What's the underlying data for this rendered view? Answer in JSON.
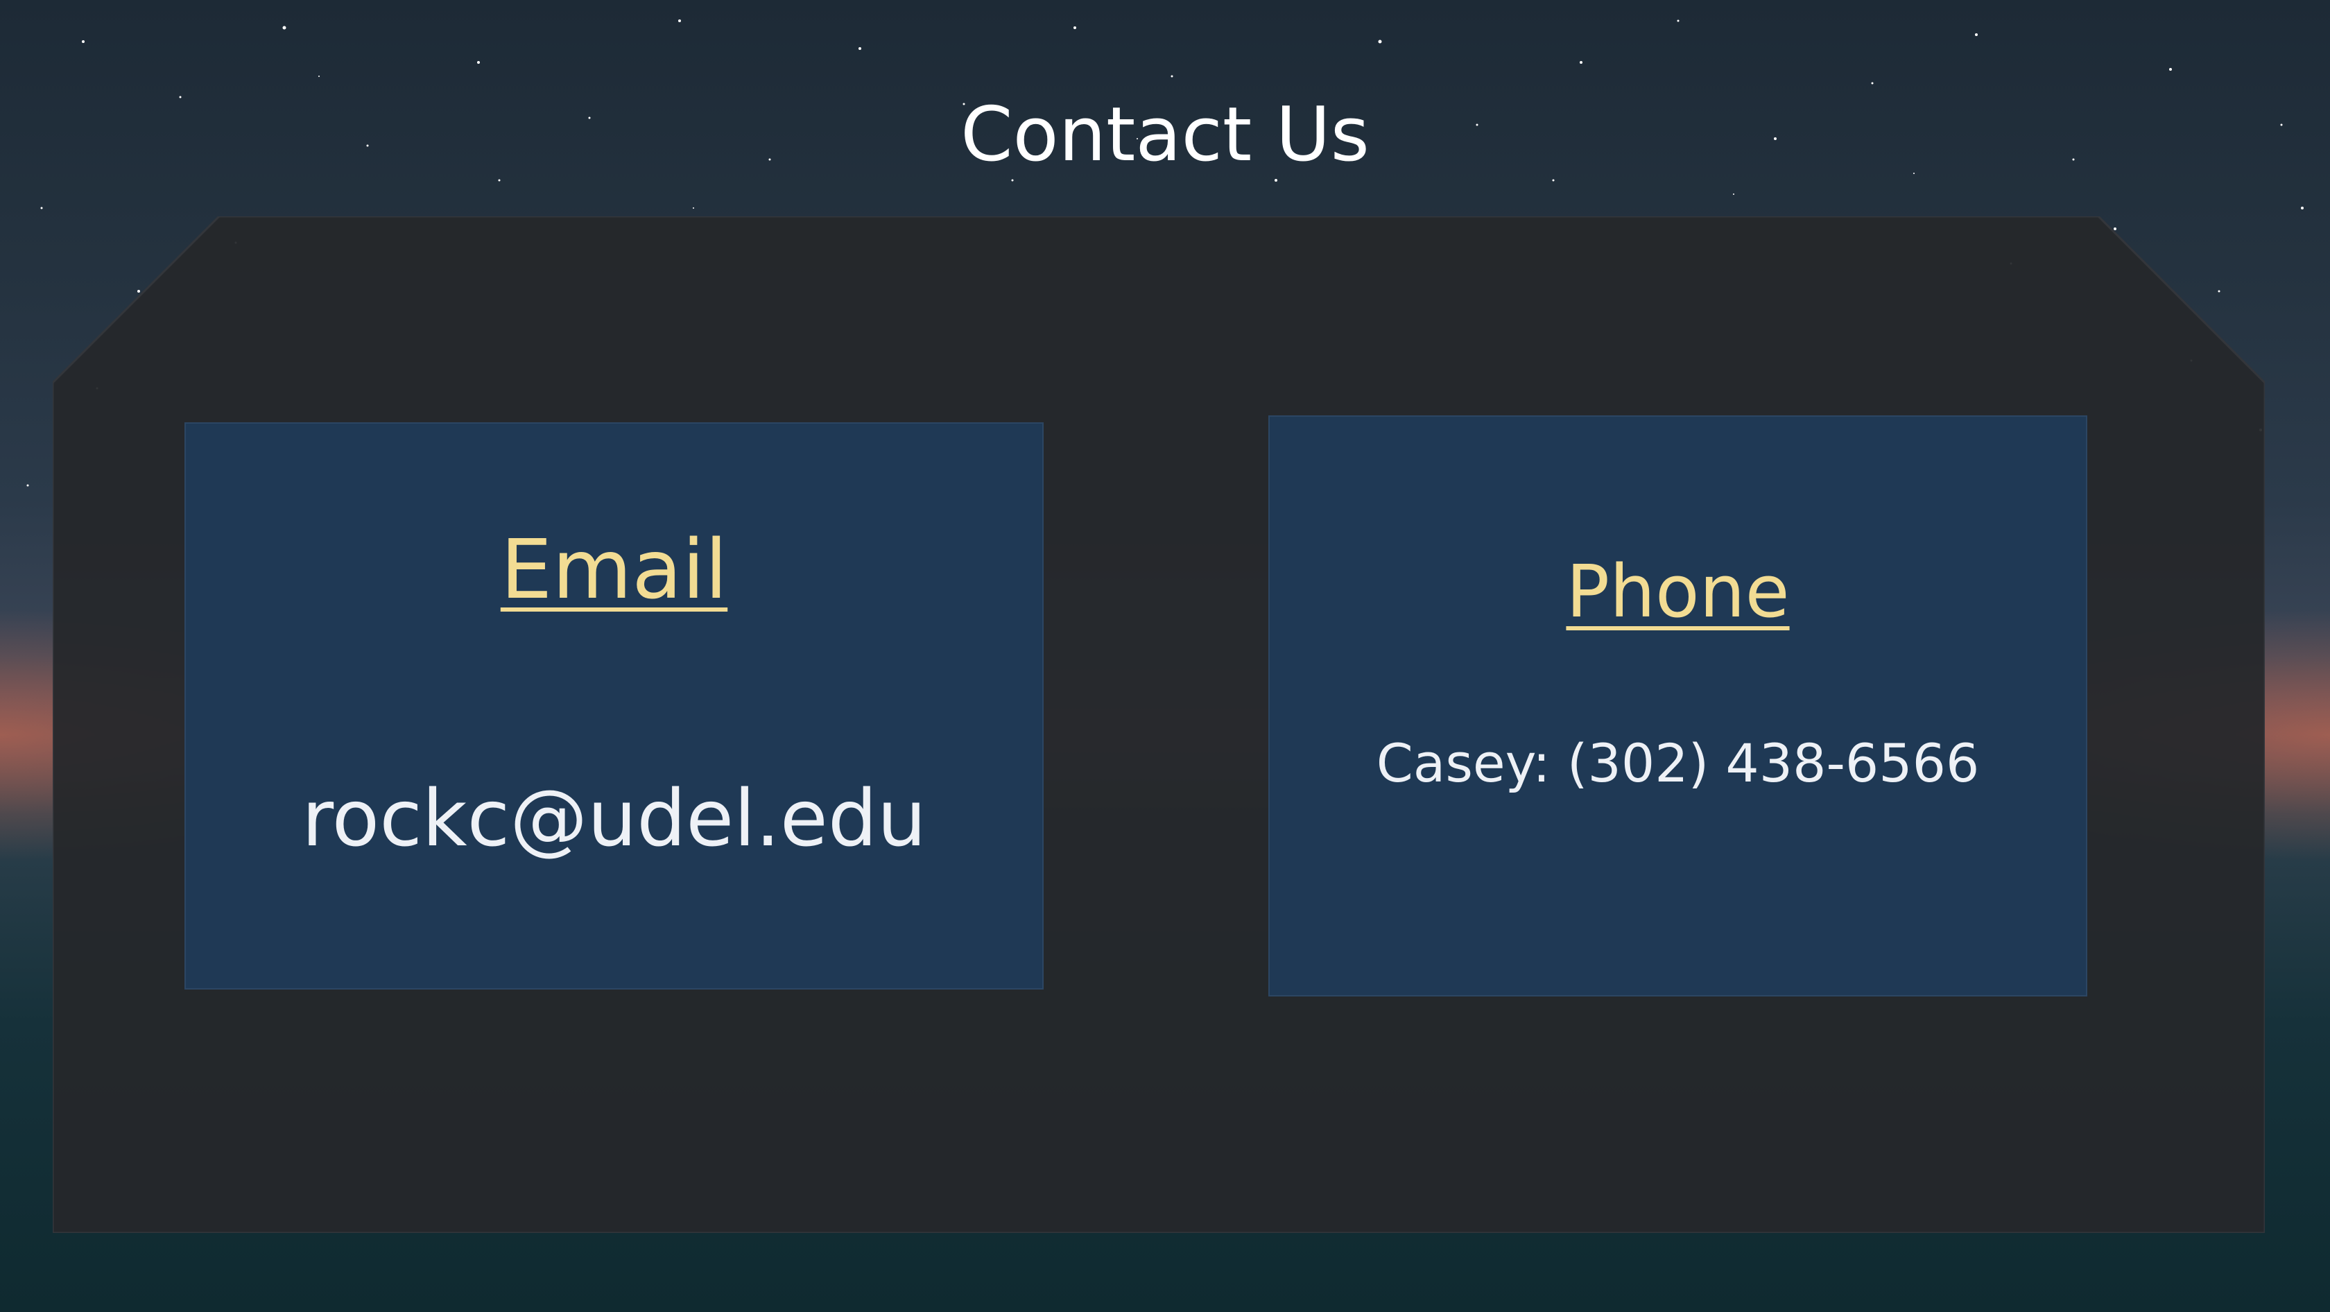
{
  "slide": {
    "title": "Contact Us"
  },
  "email_card": {
    "heading": "Email",
    "address": "rockc@udel.edu"
  },
  "phone_card": {
    "heading": "Phone",
    "contact": "Casey: (302) 438-6566"
  },
  "colors": {
    "card_background": "#1f3955",
    "heading_color": "#f2dc93",
    "body_text": "#eef1f6",
    "panel_background": "#25272b"
  }
}
